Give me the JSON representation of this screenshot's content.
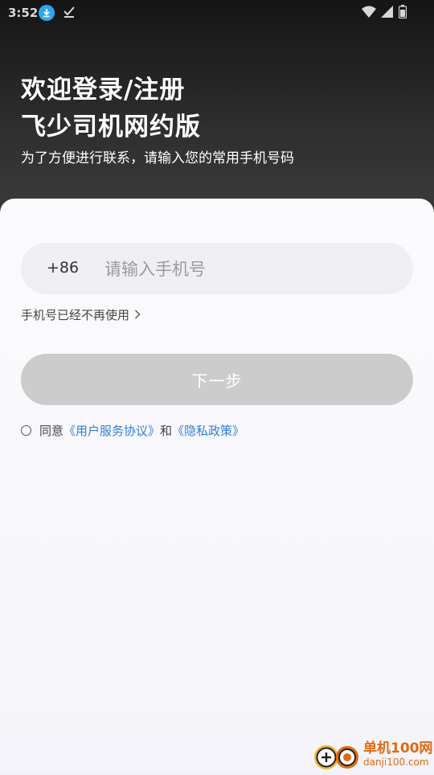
{
  "status_bar": {
    "time": "3:52"
  },
  "header": {
    "title_line_1": "欢迎登录/注册",
    "title_line_2": "飞少司机网约版",
    "subtitle": "为了方便进行联系，请输入您的常用手机号码"
  },
  "form": {
    "country_code": "+86",
    "phone_placeholder": "请输入手机号",
    "phone_value": "",
    "no_longer_used": "手机号已经不再使用",
    "next_button": "下一步"
  },
  "agreement": {
    "prefix": "同意",
    "user_agreement": "《用户服务协议》",
    "conjunction": "和",
    "privacy_policy": "《隐私政策》",
    "checked": false
  },
  "watermark": {
    "brand": "单机100网",
    "url": "danji100.com"
  },
  "colors": {
    "link": "#2f7fd8",
    "button_disabled": "#cccccc",
    "hero_dark": "#151515",
    "watermark": "#e06a12",
    "download_badge": "#2ea7f0"
  },
  "icons": [
    "download-icon",
    "check-icon",
    "wifi-icon",
    "signal-icon",
    "battery-icon",
    "chevron-right-icon"
  ]
}
